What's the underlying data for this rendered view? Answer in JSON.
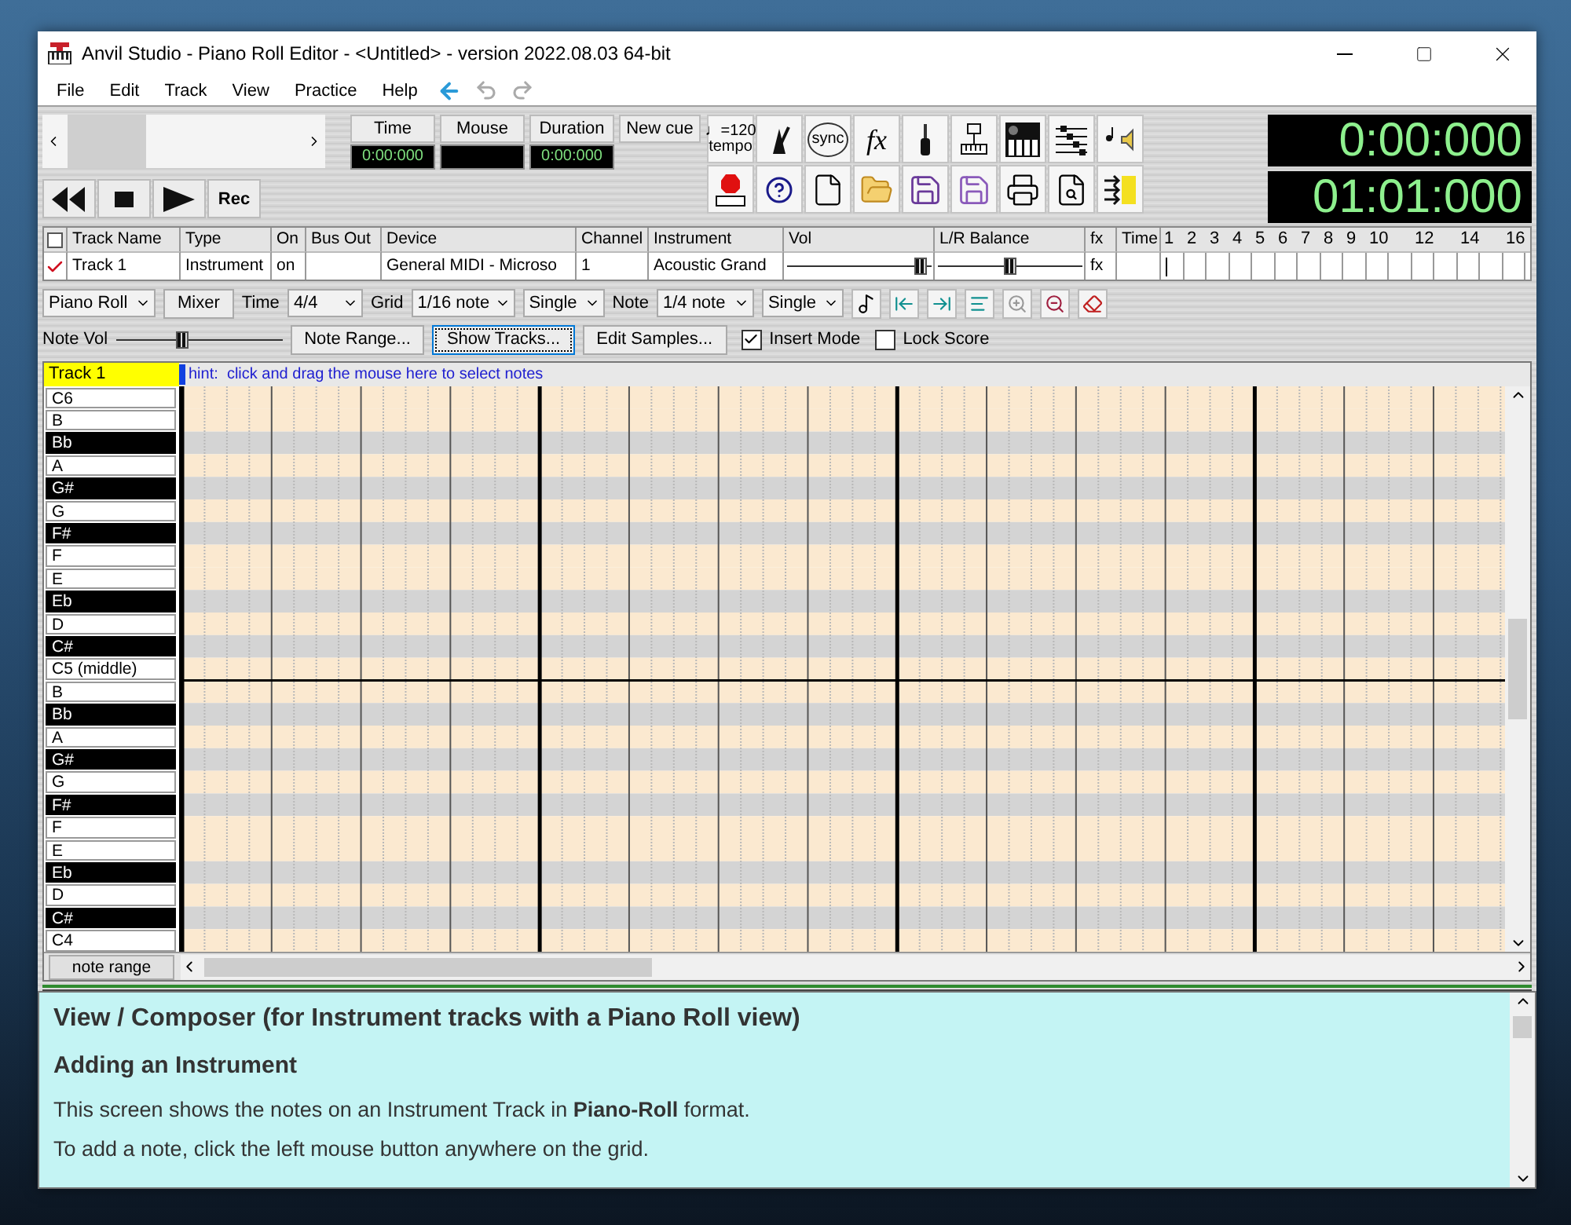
{
  "window": {
    "title": "Anvil Studio - Piano Roll Editor - <Untitled> - version 2022.08.03 64-bit"
  },
  "menu": [
    "File",
    "Edit",
    "Track",
    "View",
    "Practice",
    "Help"
  ],
  "transport": {
    "record_label": "Rec"
  },
  "readouts": [
    {
      "label": "Time",
      "value": "0:00:000"
    },
    {
      "label": "Mouse"
    },
    {
      "label": "Duration",
      "value": "0:00:000"
    }
  ],
  "new_cue": "New cue",
  "toolbar": {
    "tempo_note": "♩",
    "tempo_value": "=120",
    "tempo_label": "tempo",
    "sync_label": "sync",
    "fx_label": "fx"
  },
  "clocks": [
    "0:00:000",
    "01:01:000"
  ],
  "track_table": {
    "columns": [
      "Track Name",
      "Type",
      "On",
      "Bus Out",
      "Device",
      "Channel",
      "Instrument",
      "Vol",
      "L/R Balance",
      "fx",
      "Time"
    ],
    "all_checked": false,
    "measures": [
      "1",
      "2",
      "3",
      "4",
      "5",
      "6",
      "7",
      "8",
      "9",
      "10",
      "12",
      "14",
      "16"
    ],
    "rows": [
      {
        "checked": true,
        "name": "Track 1",
        "type": "Instrument",
        "on": "on",
        "device": "General MIDI - Microso",
        "channel": "1",
        "instrument": "Acoustic Grand",
        "vol": {
          "level": 0.93
        },
        "balance": {
          "level": 0.5
        },
        "fx": "fx"
      }
    ]
  },
  "controls": {
    "view": "Piano Roll",
    "mixer": "Mixer",
    "time_label": "Time",
    "time_signature": "4/4",
    "grid_label": "Grid",
    "grid": "1/16 note",
    "grid_mode": "Single",
    "note_label": "Note",
    "note": "1/4 note",
    "note_mode": "Single"
  },
  "note_vol": {
    "label": "Note Vol",
    "level": 0.4
  },
  "buttons": [
    {
      "label": "Note Range...",
      "focused": false
    },
    {
      "label": "Show Tracks...",
      "focused": true
    },
    {
      "label": "Edit Samples...",
      "focused": false
    }
  ],
  "checkboxes": [
    {
      "label": "Insert Mode",
      "checked": true
    },
    {
      "label": "Lock Score",
      "checked": false
    }
  ],
  "piano_roll": {
    "track_label": "Track 1",
    "hint": "hint:  click and drag the mouse here to select notes",
    "note_range": "note range",
    "keys": [
      {
        "label": "C6",
        "kind": "white"
      },
      {
        "label": "B",
        "kind": "white"
      },
      {
        "label": "Bb",
        "kind": "black"
      },
      {
        "label": "A",
        "kind": "white"
      },
      {
        "label": "G#",
        "kind": "black"
      },
      {
        "label": "G",
        "kind": "white"
      },
      {
        "label": "F#",
        "kind": "black"
      },
      {
        "label": "F",
        "kind": "white"
      },
      {
        "label": "E",
        "kind": "white"
      },
      {
        "label": "Eb",
        "kind": "black"
      },
      {
        "label": "D",
        "kind": "white"
      },
      {
        "label": "C#",
        "kind": "black"
      },
      {
        "label": "C5 (middle)",
        "kind": "white"
      },
      {
        "label": "B",
        "kind": "white"
      },
      {
        "label": "Bb",
        "kind": "black"
      },
      {
        "label": "A",
        "kind": "white"
      },
      {
        "label": "G#",
        "kind": "black"
      },
      {
        "label": "G",
        "kind": "white"
      },
      {
        "label": "F#",
        "kind": "black"
      },
      {
        "label": "F",
        "kind": "white"
      },
      {
        "label": "E",
        "kind": "white"
      },
      {
        "label": "Eb",
        "kind": "black"
      },
      {
        "label": "D",
        "kind": "white"
      },
      {
        "label": "C#",
        "kind": "black"
      },
      {
        "label": "C4",
        "kind": "white"
      }
    ]
  },
  "help": {
    "heading": "View / Composer (for Instrument tracks with a Piano Roll view)",
    "subheading": "Adding an Instrument",
    "paragraphs": [
      "This screen shows the notes on an Instrument Track in **Piano-Roll** format.",
      "To add a note, click the left mouse button anywhere on the grid."
    ]
  }
}
